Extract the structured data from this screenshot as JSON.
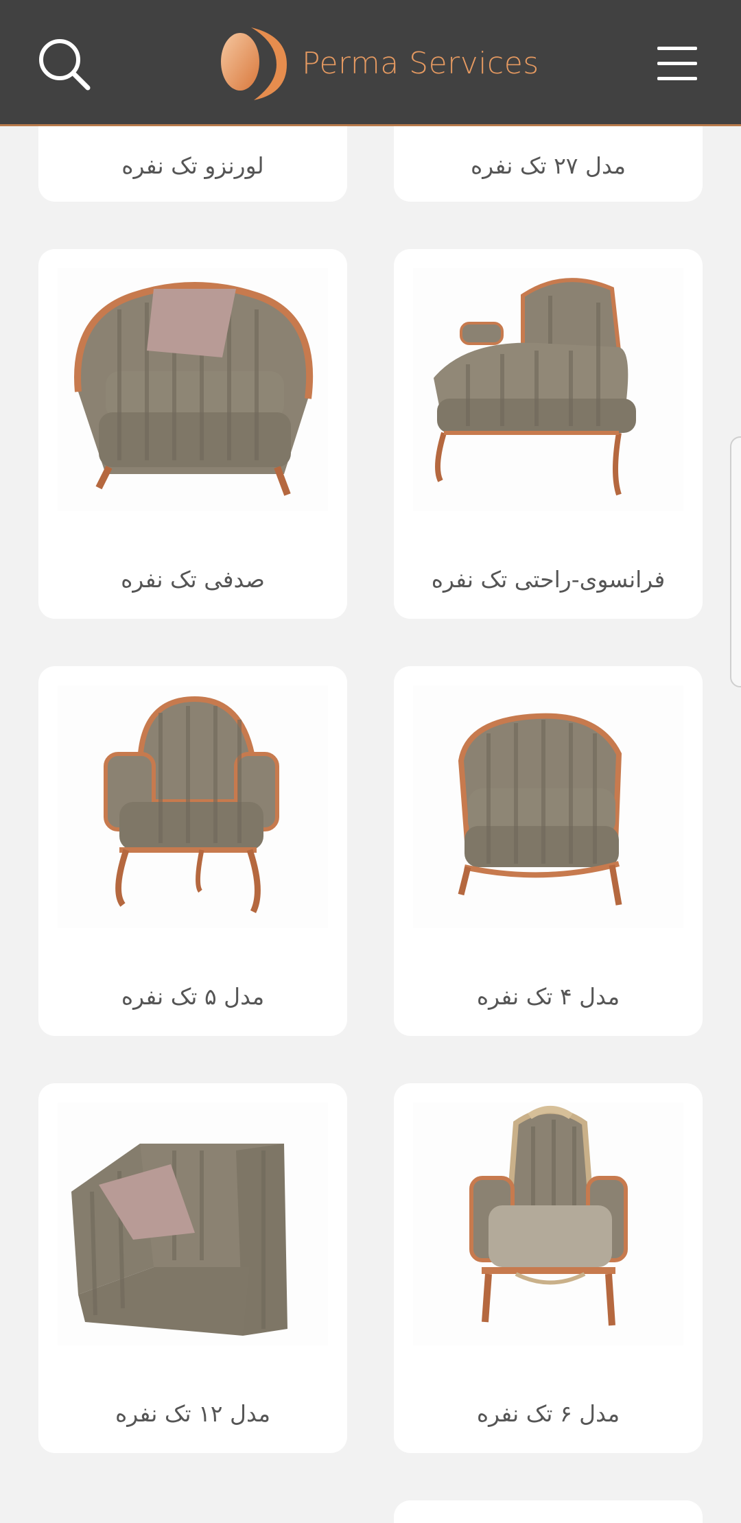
{
  "header": {
    "brand_name": "Perma Services",
    "colors": {
      "bar": "#414141",
      "accent": "#e69a61"
    },
    "icons": {
      "search": "search-icon",
      "menu": "hamburger-menu-icon",
      "logo": "perma-logo-icon"
    }
  },
  "products": [
    {
      "title": "لورنزو تک نفره",
      "image": "armchair-image"
    },
    {
      "title": "مدل ۲۷ تک نفره",
      "image": "armchair-image"
    },
    {
      "title": "صدفی تک نفره",
      "image": "shell-armchair-image"
    },
    {
      "title": "فرانسوی-راحتی تک نفره",
      "image": "french-chaise-image"
    },
    {
      "title": "مدل ۵ تک نفره",
      "image": "classic-armchair-image"
    },
    {
      "title": "مدل ۴ تک نفره",
      "image": "tub-armchair-image"
    },
    {
      "title": "مدل ۱۲ تک نفره",
      "image": "modern-armchair-image"
    },
    {
      "title": "مدل ۶ تک نفره",
      "image": "royal-armchair-image"
    }
  ]
}
